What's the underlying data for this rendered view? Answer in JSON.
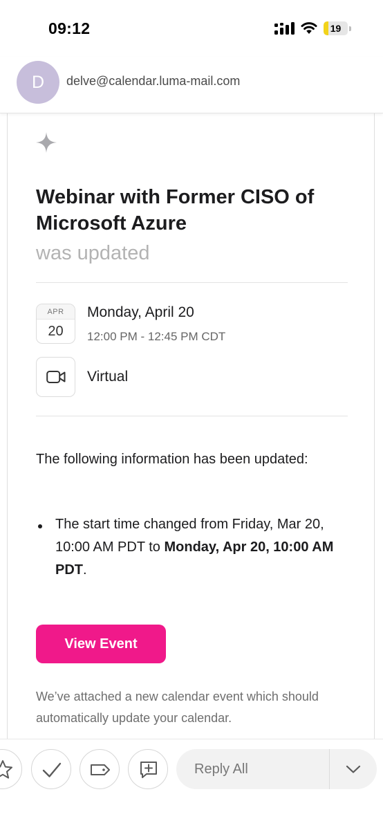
{
  "status_bar": {
    "time": "09:12",
    "battery_level": "19",
    "battery_fraction": 0.19,
    "icons": [
      "cellular-signal-icon",
      "wifi-icon",
      "battery-icon"
    ]
  },
  "sender": {
    "avatar_initial": "D",
    "avatar_color": "#c7bedb",
    "email": "delve@calendar.luma-mail.com"
  },
  "email": {
    "title": "Webinar with Former CISO of Microsoft Azure",
    "status": "was updated",
    "date_badge": {
      "month": "APR",
      "day": "20"
    },
    "date_text": "Monday, April 20",
    "time_text": "12:00 PM - 12:45 PM CDT",
    "location": "Virtual",
    "intro": "The following information has been updated:",
    "change": {
      "prefix": "The start time changed from Friday, Mar 20, 10:00 AM PDT to ",
      "new_value": "Monday, Apr 20, 10:00 AM PDT",
      "suffix": "."
    },
    "button_label": "View Event",
    "footer_note": "We’ve attached a new calendar event which should automatically update your calendar."
  },
  "toolbar": {
    "reply_label": "Reply All",
    "buttons": [
      "star-icon",
      "checkmark-icon",
      "tag-icon",
      "add-comment-icon",
      "chevron-down-icon"
    ]
  },
  "colors": {
    "accent": "#f0198a",
    "battery": "#f2d31b",
    "muted_text": "#b3b3b3"
  }
}
